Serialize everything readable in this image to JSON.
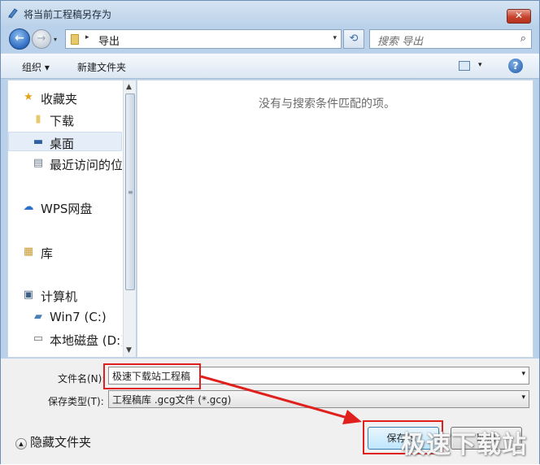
{
  "window": {
    "title": "将当前工程稿另存为",
    "close_glyph": "✕"
  },
  "nav": {
    "back_glyph": "←",
    "forward_glyph": "→",
    "history_glyph": "▾",
    "address_path": "导出",
    "address_sep": "▸",
    "address_drop": "▾",
    "refresh_glyph": "⟲",
    "search_placeholder": "搜索 导出",
    "search_glyph": "⌕"
  },
  "toolbar": {
    "organize": "组织 ▾",
    "new_folder": "新建文件夹",
    "view_drop": "▾",
    "help": "?"
  },
  "sidebar": {
    "items": [
      {
        "label": "收藏夹",
        "icon": "star-icon",
        "glyph": "★",
        "color": "#e3a21a"
      },
      {
        "label": "下载",
        "icon": "folder-icon",
        "glyph": "▮",
        "color": "#e7c86a"
      },
      {
        "label": "桌面",
        "icon": "desktop-icon",
        "glyph": "▬",
        "color": "#2f5f9e"
      },
      {
        "label": "最近访问的位置",
        "icon": "recent-places-icon",
        "glyph": "▤",
        "color": "#6a7a8a"
      },
      {
        "label": "WPS网盘",
        "icon": "cloud-icon",
        "glyph": "☁",
        "color": "#2a6fc9"
      },
      {
        "label": "库",
        "icon": "library-icon",
        "glyph": "▦",
        "color": "#c79a35"
      },
      {
        "label": "计算机",
        "icon": "computer-icon",
        "glyph": "▣",
        "color": "#3f5e80"
      },
      {
        "label": "Win7 (C:)",
        "icon": "system-drive-icon",
        "glyph": "▰",
        "color": "#4a7fb8"
      },
      {
        "label": "本地磁盘 (D:)",
        "icon": "drive-icon",
        "glyph": "▭",
        "color": "#6d6d6d"
      }
    ],
    "scroll_up": "▲",
    "scroll_down": "▼",
    "grip": "≡"
  },
  "content": {
    "empty_message": "没有与搜索条件匹配的项。"
  },
  "form": {
    "filename_label": "文件名(N):",
    "filename_value": "极速下载站工程稿",
    "filetype_label": "保存类型(T):",
    "filetype_value": "工程稿库 .gcg文件 (*.gcg)",
    "dropdown_glyph": "▾",
    "hide_folders": "隐藏文件夹",
    "hide_folders_glyph": "▲",
    "save_button": "保存(S)",
    "cancel_button": "取消"
  },
  "annotation_color": "#e0201d",
  "watermark": "极速下载站"
}
